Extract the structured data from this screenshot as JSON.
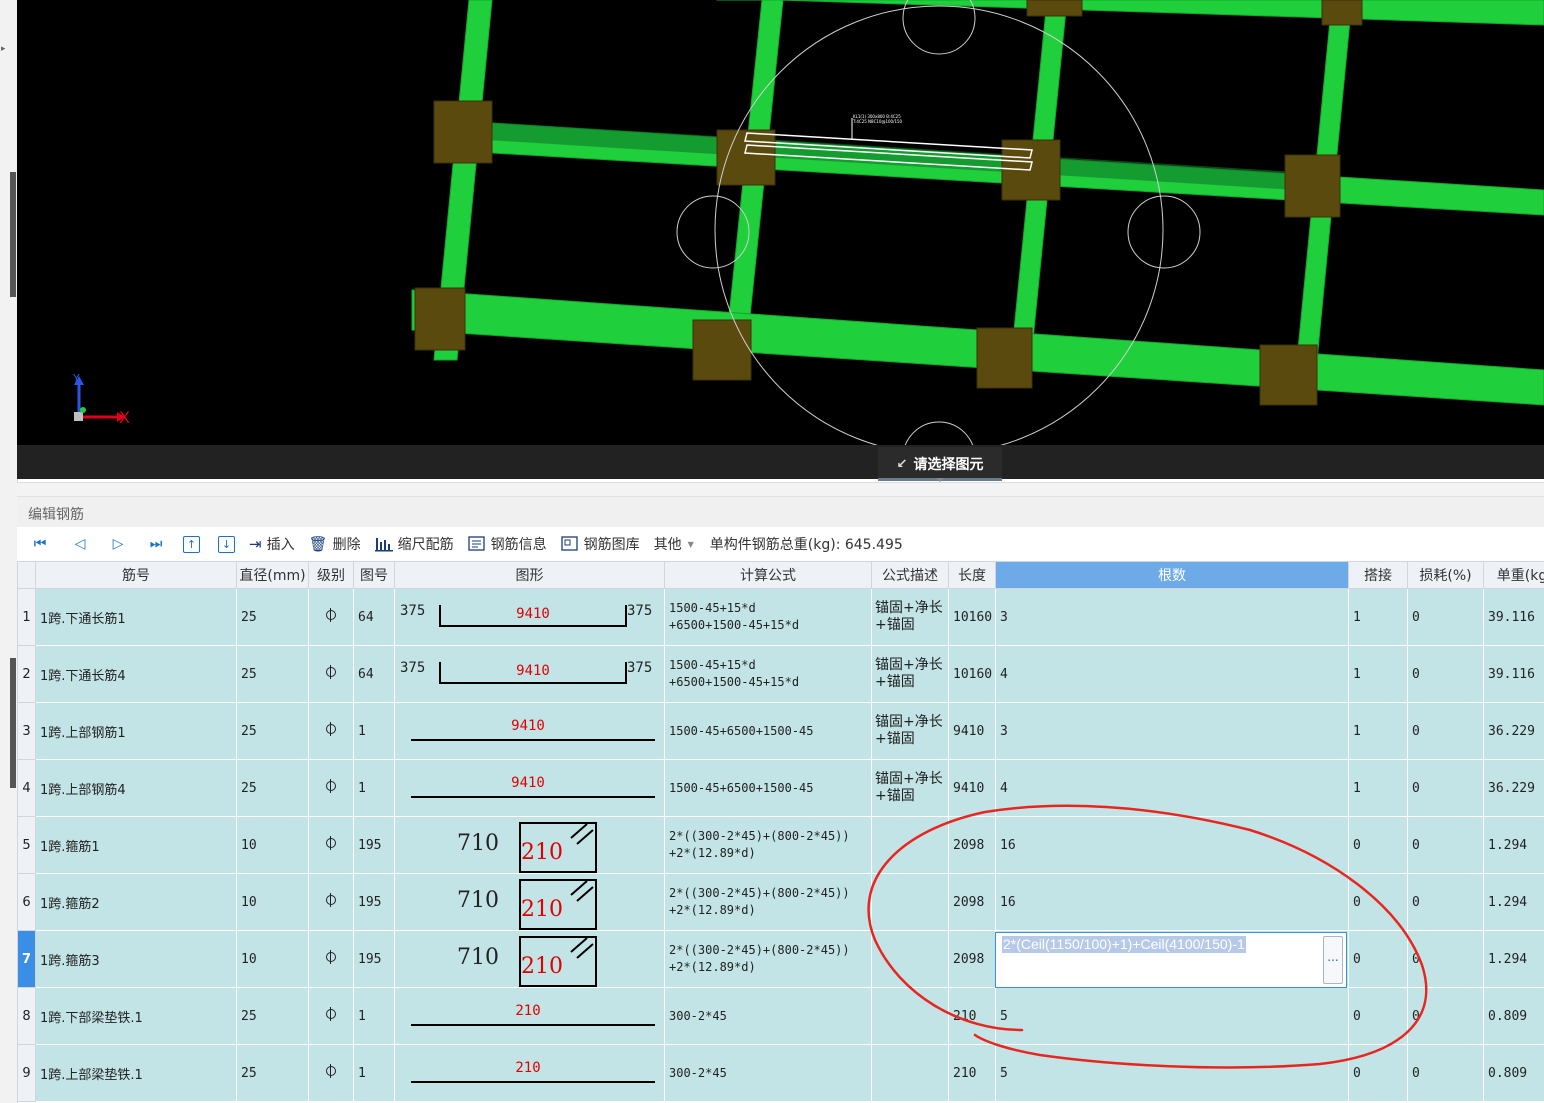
{
  "viewport": {
    "prompt": "请选择图元",
    "axis_x": "X",
    "axis_y": "Y"
  },
  "panel": {
    "title": "编辑钢筋"
  },
  "toolbar": {
    "insert": "插入",
    "delete": "删除",
    "scale_rebar": "缩尺配筋",
    "rebar_info": "钢筋信息",
    "rebar_library": "钢筋图库",
    "other": "其他",
    "total_weight": "单构件钢筋总重(kg): 645.495"
  },
  "table": {
    "headers": {
      "name": "筋号",
      "diameter": "直径(mm)",
      "grade": "级别",
      "shape_no": "图号",
      "shape": "图形",
      "formula": "计算公式",
      "formula_desc": "公式描述",
      "length": "长度",
      "count": "根数",
      "lap": "搭接",
      "loss": "损耗(%)",
      "unit_weight": "单重(kg"
    },
    "rows": [
      {
        "num": "1",
        "name": "1跨.下通长筋1",
        "diameter": "25",
        "shape_no": "64",
        "shape_type": "hook",
        "shape_left": "375",
        "shape_mid": "9410",
        "shape_right": "375",
        "formula_l1": "1500-45+15*d",
        "formula_l2": "+6500+1500-45+15*d",
        "desc_l1": "锚固+净长",
        "desc_l2": "+锚固",
        "length": "10160",
        "count": "3",
        "lap": "1",
        "loss": "0",
        "unit_weight": "39.116"
      },
      {
        "num": "2",
        "name": "1跨.下通长筋4",
        "diameter": "25",
        "shape_no": "64",
        "shape_type": "hook",
        "shape_left": "375",
        "shape_mid": "9410",
        "shape_right": "375",
        "formula_l1": "1500-45+15*d",
        "formula_l2": "+6500+1500-45+15*d",
        "desc_l1": "锚固+净长",
        "desc_l2": "+锚固",
        "length": "10160",
        "count": "4",
        "lap": "1",
        "loss": "0",
        "unit_weight": "39.116"
      },
      {
        "num": "3",
        "name": "1跨.上部钢筋1",
        "diameter": "25",
        "shape_no": "1",
        "shape_type": "straight",
        "shape_mid": "9410",
        "formula_l1": "1500-45+6500+1500-45",
        "formula_l2": "",
        "desc_l1": "锚固+净长",
        "desc_l2": "+锚固",
        "length": "9410",
        "count": "3",
        "lap": "1",
        "loss": "0",
        "unit_weight": "36.229"
      },
      {
        "num": "4",
        "name": "1跨.上部钢筋4",
        "diameter": "25",
        "shape_no": "1",
        "shape_type": "straight",
        "shape_mid": "9410",
        "formula_l1": "1500-45+6500+1500-45",
        "formula_l2": "",
        "desc_l1": "锚固+净长",
        "desc_l2": "+锚固",
        "length": "9410",
        "count": "4",
        "lap": "1",
        "loss": "0",
        "unit_weight": "36.229"
      },
      {
        "num": "5",
        "name": "1跨.箍筋1",
        "diameter": "10",
        "shape_no": "195",
        "shape_type": "stirrup",
        "shape_left": "710",
        "shape_mid": "210",
        "formula_l1": "2*((300-2*45)+(800-2*45))",
        "formula_l2": "+2*(12.89*d)",
        "desc_l1": "",
        "desc_l2": "",
        "length": "2098",
        "count": "16",
        "lap": "0",
        "loss": "0",
        "unit_weight": "1.294"
      },
      {
        "num": "6",
        "name": "1跨.箍筋2",
        "diameter": "10",
        "shape_no": "195",
        "shape_type": "stirrup",
        "shape_left": "710",
        "shape_mid": "210",
        "formula_l1": "2*((300-2*45)+(800-2*45))",
        "formula_l2": "+2*(12.89*d)",
        "desc_l1": "",
        "desc_l2": "",
        "length": "2098",
        "count": "16",
        "lap": "0",
        "loss": "0",
        "unit_weight": "1.294"
      },
      {
        "num": "7",
        "name": "1跨.箍筋3",
        "diameter": "10",
        "shape_no": "195",
        "shape_type": "stirrup",
        "shape_left": "710",
        "shape_mid": "210",
        "formula_l1": "2*((300-2*45)+(800-2*45))",
        "formula_l2": "+2*(12.89*d)",
        "desc_l1": "",
        "desc_l2": "",
        "length": "2098",
        "count": "",
        "lap": "0",
        "loss": "0",
        "unit_weight": "1.294"
      },
      {
        "num": "8",
        "name": "1跨.下部梁垫铁.1",
        "diameter": "25",
        "shape_no": "1",
        "shape_type": "straight",
        "shape_mid": "210",
        "formula_l1": "300-2*45",
        "formula_l2": "",
        "desc_l1": "",
        "desc_l2": "",
        "length": "210",
        "count": "5",
        "lap": "0",
        "loss": "0",
        "unit_weight": "0.809"
      },
      {
        "num": "9",
        "name": "1跨.上部梁垫铁.1",
        "diameter": "25",
        "shape_no": "1",
        "shape_type": "straight",
        "shape_mid": "210",
        "formula_l1": "300-2*45",
        "formula_l2": "",
        "desc_l1": "",
        "desc_l2": "",
        "length": "210",
        "count": "5",
        "lap": "0",
        "loss": "0",
        "unit_weight": "0.809"
      }
    ],
    "editor_value": "2*(Ceil(1150/100)+1)+Ceil(4100/150)-1",
    "editor_button": "..."
  },
  "beam_tooltip": {
    "line1": "KL1(1) 300x800 B:4C25",
    "line2": "T:4C25 N8C10@100/150"
  }
}
